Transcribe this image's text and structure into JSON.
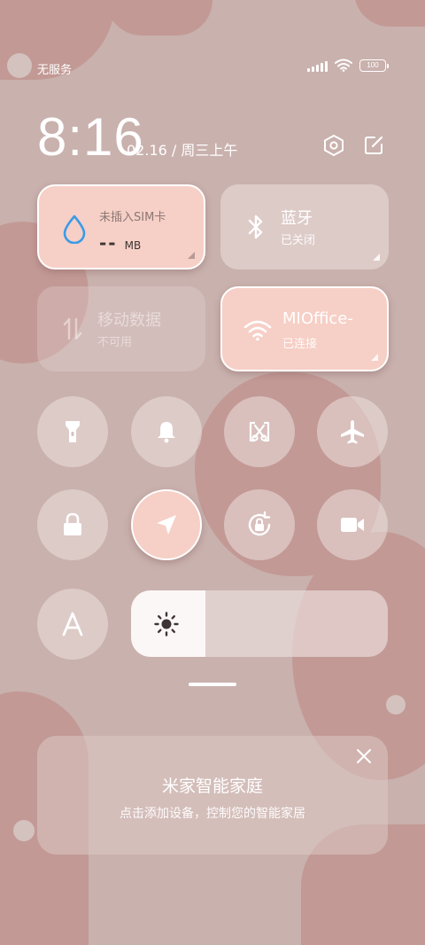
{
  "status_bar": {
    "carrier": "无服务",
    "battery": "100",
    "icons": [
      "signal-icon",
      "wifi-icon",
      "battery-icon"
    ]
  },
  "header": {
    "time": "8:16",
    "date": "02.16 / 周三上午",
    "icons": [
      "settings-icon",
      "edit-icon"
    ]
  },
  "tiles": {
    "data_usage": {
      "label": "未插入SIM卡",
      "value": "--",
      "unit": "MB",
      "state": "active",
      "icon": "water-drop-icon"
    },
    "bluetooth": {
      "label": "蓝牙",
      "status": "已关闭",
      "state": "off",
      "icon": "bluetooth-icon"
    },
    "mobile_data": {
      "label": "移动数据",
      "status": "不可用",
      "state": "disabled",
      "icon": "mobile-data-icon"
    },
    "wifi": {
      "label": "MIOffice-",
      "status": "已连接",
      "state": "active",
      "icon": "wifi-icon"
    }
  },
  "toggles": [
    {
      "name": "flashlight",
      "icon": "flashlight-icon",
      "state": "off"
    },
    {
      "name": "ringer",
      "icon": "bell-icon",
      "state": "off"
    },
    {
      "name": "screenshot",
      "icon": "scissors-icon",
      "state": "off"
    },
    {
      "name": "airplane",
      "icon": "airplane-icon",
      "state": "off"
    },
    {
      "name": "lock",
      "icon": "lock-icon",
      "state": "off"
    },
    {
      "name": "location",
      "icon": "location-arrow-icon",
      "state": "on"
    },
    {
      "name": "rotation_lock",
      "icon": "rotation-lock-icon",
      "state": "off"
    },
    {
      "name": "screen_record",
      "icon": "video-camera-icon",
      "state": "off"
    },
    {
      "name": "auto_brightness",
      "icon": "letter-a-icon",
      "state": "off"
    }
  ],
  "brightness": {
    "level": 0.29,
    "icon": "sun-icon"
  },
  "smart_home_card": {
    "title": "米家智能家庭",
    "subtitle": "点击添加设备，控制您的智能家居",
    "close_icon": "close-icon"
  },
  "colors": {
    "background": "#c9b1ad",
    "active_tile": "#f6cfc6",
    "accent_blue": "#3a9be8"
  }
}
